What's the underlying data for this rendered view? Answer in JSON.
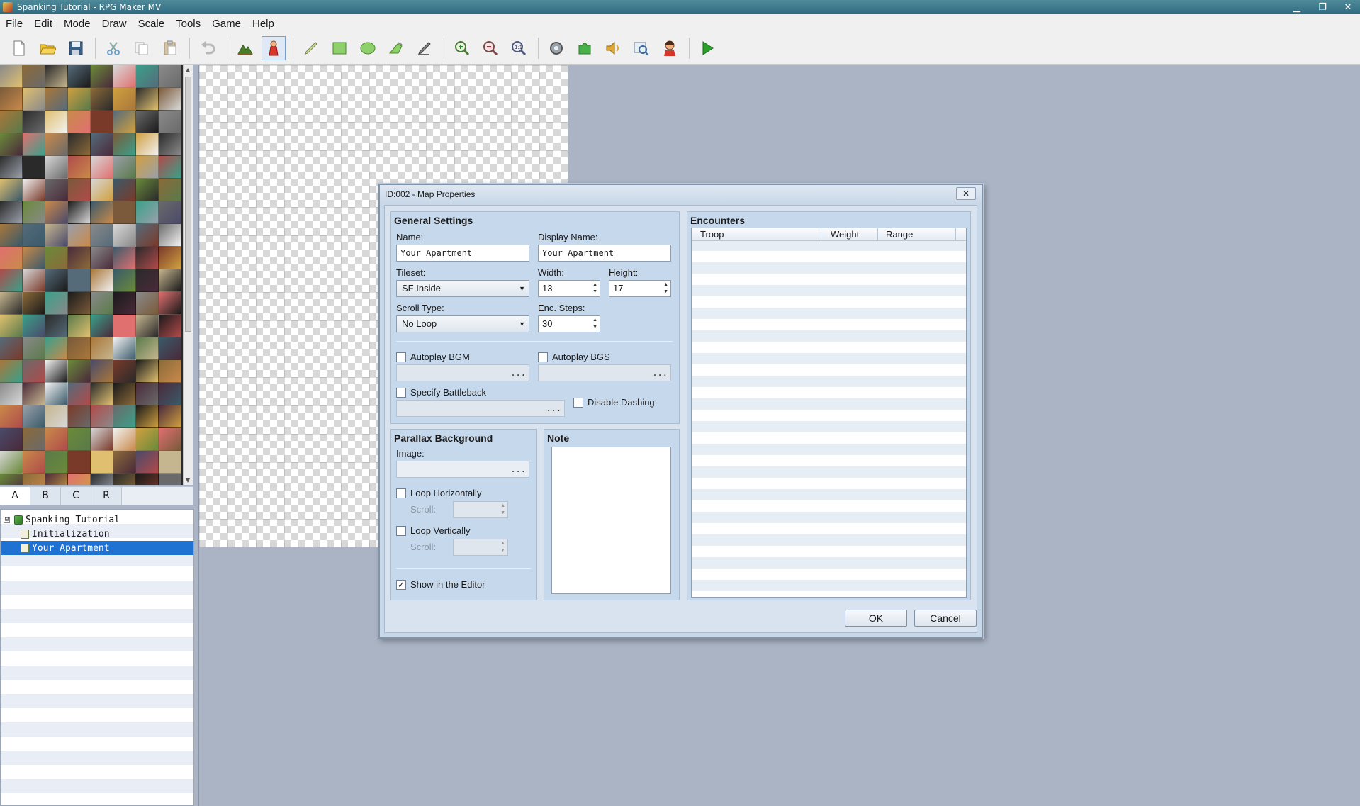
{
  "window": {
    "title": "Spanking Tutorial - RPG Maker MV",
    "controls": [
      "minimize",
      "restore",
      "close"
    ]
  },
  "menu": [
    "File",
    "Edit",
    "Mode",
    "Draw",
    "Scale",
    "Tools",
    "Game",
    "Help"
  ],
  "toolbar": {
    "groups": [
      [
        "new-project-icon",
        "open-project-icon",
        "save-project-icon"
      ],
      [
        "cut-icon",
        "copy-icon",
        "paste-icon"
      ],
      [
        "undo-icon"
      ],
      [
        "map-mode-icon",
        "event-mode-icon"
      ],
      [
        "pencil-icon",
        "rectangle-icon",
        "ellipse-icon",
        "fill-icon",
        "shadow-pen-icon"
      ],
      [
        "zoom-in-icon",
        "zoom-out-icon",
        "actual-size-icon"
      ],
      [
        "database-icon",
        "plugin-manager-icon",
        "sound-test-icon",
        "event-searcher-icon",
        "character-generator-icon"
      ],
      [
        "playtest-icon"
      ]
    ],
    "active": "event-mode-icon"
  },
  "palette_tabs": [
    "A",
    "B",
    "C",
    "R"
  ],
  "palette_selected_tab": "A",
  "map_tree": [
    {
      "label": "Spanking Tutorial",
      "level": 0,
      "expander": "⊟"
    },
    {
      "label": "Initialization",
      "level": 1
    },
    {
      "label": "Your Apartment",
      "level": 1,
      "selected": true
    }
  ],
  "dialog": {
    "title": "ID:002 - Map Properties",
    "close_label": "✕",
    "general": {
      "title": "General Settings",
      "name_label": "Name:",
      "name_value": "Your Apartment",
      "display_name_label": "Display Name:",
      "display_name_value": "Your Apartment",
      "tileset_label": "Tileset:",
      "tileset_value": "SF Inside",
      "width_label": "Width:",
      "width_value": "13",
      "height_label": "Height:",
      "height_value": "17",
      "scroll_type_label": "Scroll Type:",
      "scroll_type_value": "No Loop",
      "enc_steps_label": "Enc. Steps:",
      "enc_steps_value": "30",
      "autoplay_bgm_label": "Autoplay BGM",
      "autoplay_bgs_label": "Autoplay BGS",
      "specify_battleback_label": "Specify Battleback",
      "disable_dashing_label": "Disable Dashing",
      "ellipsis": "..."
    },
    "parallax": {
      "title": "Parallax Background",
      "image_label": "Image:",
      "loop_h_label": "Loop Horizontally",
      "loop_v_label": "Loop Vertically",
      "scroll_label": "Scroll:",
      "show_in_editor_label": "Show in the Editor",
      "show_in_editor_checked": "✓"
    },
    "note": {
      "title": "Note"
    },
    "encounters": {
      "title": "Encounters",
      "columns": [
        "Troop",
        "Weight",
        "Range"
      ]
    },
    "ok_label": "OK",
    "cancel_label": "Cancel"
  },
  "colors": {
    "tree_selected": "#1f71d2",
    "dialog_bg": "#c9d8e8",
    "workspace_bg": "#aab4c4"
  }
}
